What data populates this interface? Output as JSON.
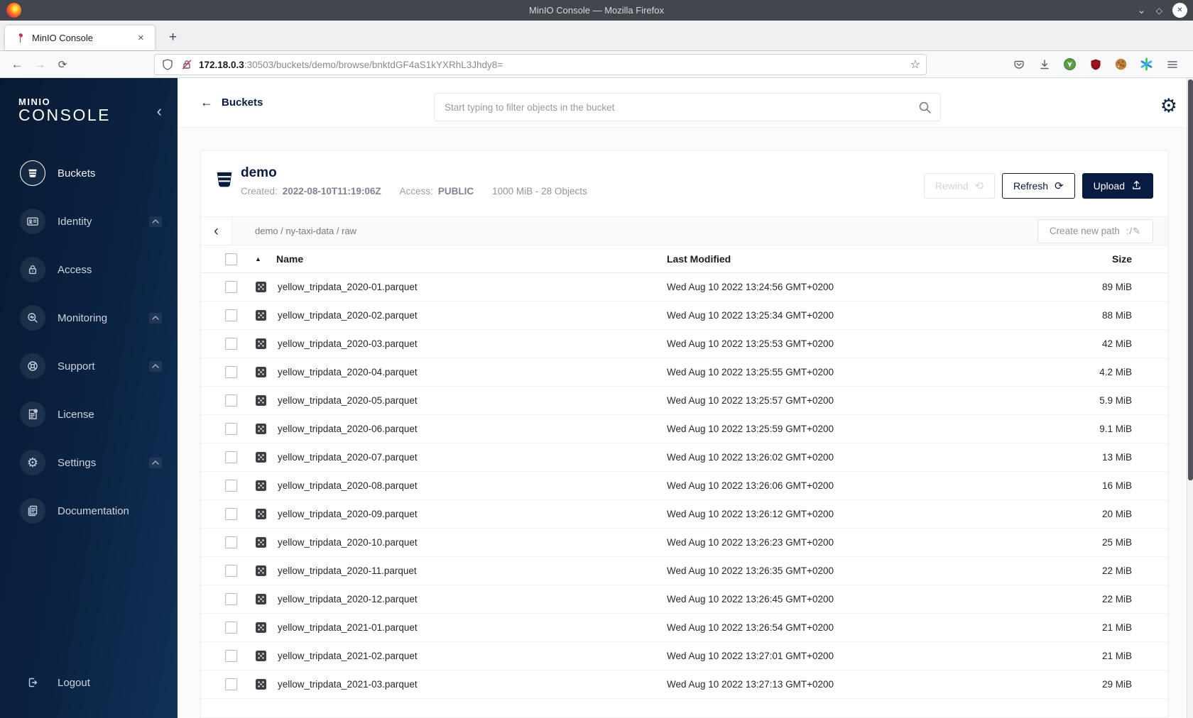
{
  "window": {
    "title": "MinIO Console — Mozilla Firefox"
  },
  "browser": {
    "tab_title": "MinIO Console",
    "url_host": "172.18.0.3",
    "url_path": ":30503/buckets/demo/browse/bnktdGF4aS1kYXRhL3Jhdy8="
  },
  "icons": {
    "minimize": "⌄",
    "maximize": "◇",
    "close": "✕",
    "tab_close": "✕",
    "new_tab": "+",
    "back": "←",
    "forward": "→",
    "reload": "⟳",
    "bookmark_star": "☆",
    "sidebar_collapse": "‹",
    "crumb_back": "‹",
    "sort_asc": "▲",
    "rewind": "⟲",
    "refresh": "⟳",
    "gear": "⚙",
    "create_path": ":/✎",
    "header_back": "←"
  },
  "sidebar": {
    "logo_line1": "MINIO",
    "logo_line2": "CONSOLE",
    "items": [
      {
        "label": "Buckets"
      },
      {
        "label": "Identity"
      },
      {
        "label": "Access"
      },
      {
        "label": "Monitoring"
      },
      {
        "label": "Support"
      },
      {
        "label": "License"
      },
      {
        "label": "Settings"
      },
      {
        "label": "Documentation"
      }
    ],
    "logout_label": "Logout"
  },
  "header": {
    "back_label": "Buckets",
    "search_placeholder": "Start typing to filter objects in the bucket"
  },
  "bucket": {
    "name": "demo",
    "created_label": "Created:",
    "created_value": "2022-08-10T11:19:06Z",
    "access_label": "Access:",
    "access_value": "PUBLIC",
    "usage": "1000 MiB - 28 Objects",
    "rewind_label": "Rewind",
    "refresh_label": "Refresh",
    "upload_label": "Upload"
  },
  "browse": {
    "breadcrumb": "demo / ny-taxi-data / raw",
    "create_path_label": "Create new path"
  },
  "table": {
    "col_name": "Name",
    "col_modified": "Last Modified",
    "col_size": "Size",
    "rows": [
      {
        "name": "yellow_tripdata_2020-01.parquet",
        "modified": "Wed Aug 10 2022 13:24:56 GMT+0200",
        "size": "89 MiB"
      },
      {
        "name": "yellow_tripdata_2020-02.parquet",
        "modified": "Wed Aug 10 2022 13:25:34 GMT+0200",
        "size": "88 MiB"
      },
      {
        "name": "yellow_tripdata_2020-03.parquet",
        "modified": "Wed Aug 10 2022 13:25:53 GMT+0200",
        "size": "42 MiB"
      },
      {
        "name": "yellow_tripdata_2020-04.parquet",
        "modified": "Wed Aug 10 2022 13:25:55 GMT+0200",
        "size": "4.2 MiB"
      },
      {
        "name": "yellow_tripdata_2020-05.parquet",
        "modified": "Wed Aug 10 2022 13:25:57 GMT+0200",
        "size": "5.9 MiB"
      },
      {
        "name": "yellow_tripdata_2020-06.parquet",
        "modified": "Wed Aug 10 2022 13:25:59 GMT+0200",
        "size": "9.1 MiB"
      },
      {
        "name": "yellow_tripdata_2020-07.parquet",
        "modified": "Wed Aug 10 2022 13:26:02 GMT+0200",
        "size": "13 MiB"
      },
      {
        "name": "yellow_tripdata_2020-08.parquet",
        "modified": "Wed Aug 10 2022 13:26:06 GMT+0200",
        "size": "16 MiB"
      },
      {
        "name": "yellow_tripdata_2020-09.parquet",
        "modified": "Wed Aug 10 2022 13:26:12 GMT+0200",
        "size": "20 MiB"
      },
      {
        "name": "yellow_tripdata_2020-10.parquet",
        "modified": "Wed Aug 10 2022 13:26:23 GMT+0200",
        "size": "25 MiB"
      },
      {
        "name": "yellow_tripdata_2020-11.parquet",
        "modified": "Wed Aug 10 2022 13:26:35 GMT+0200",
        "size": "22 MiB"
      },
      {
        "name": "yellow_tripdata_2020-12.parquet",
        "modified": "Wed Aug 10 2022 13:26:45 GMT+0200",
        "size": "22 MiB"
      },
      {
        "name": "yellow_tripdata_2021-01.parquet",
        "modified": "Wed Aug 10 2022 13:26:54 GMT+0200",
        "size": "21 MiB"
      },
      {
        "name": "yellow_tripdata_2021-02.parquet",
        "modified": "Wed Aug 10 2022 13:27:01 GMT+0200",
        "size": "21 MiB"
      },
      {
        "name": "yellow_tripdata_2021-03.parquet",
        "modified": "Wed Aug 10 2022 13:27:13 GMT+0200",
        "size": "29 MiB"
      }
    ]
  }
}
